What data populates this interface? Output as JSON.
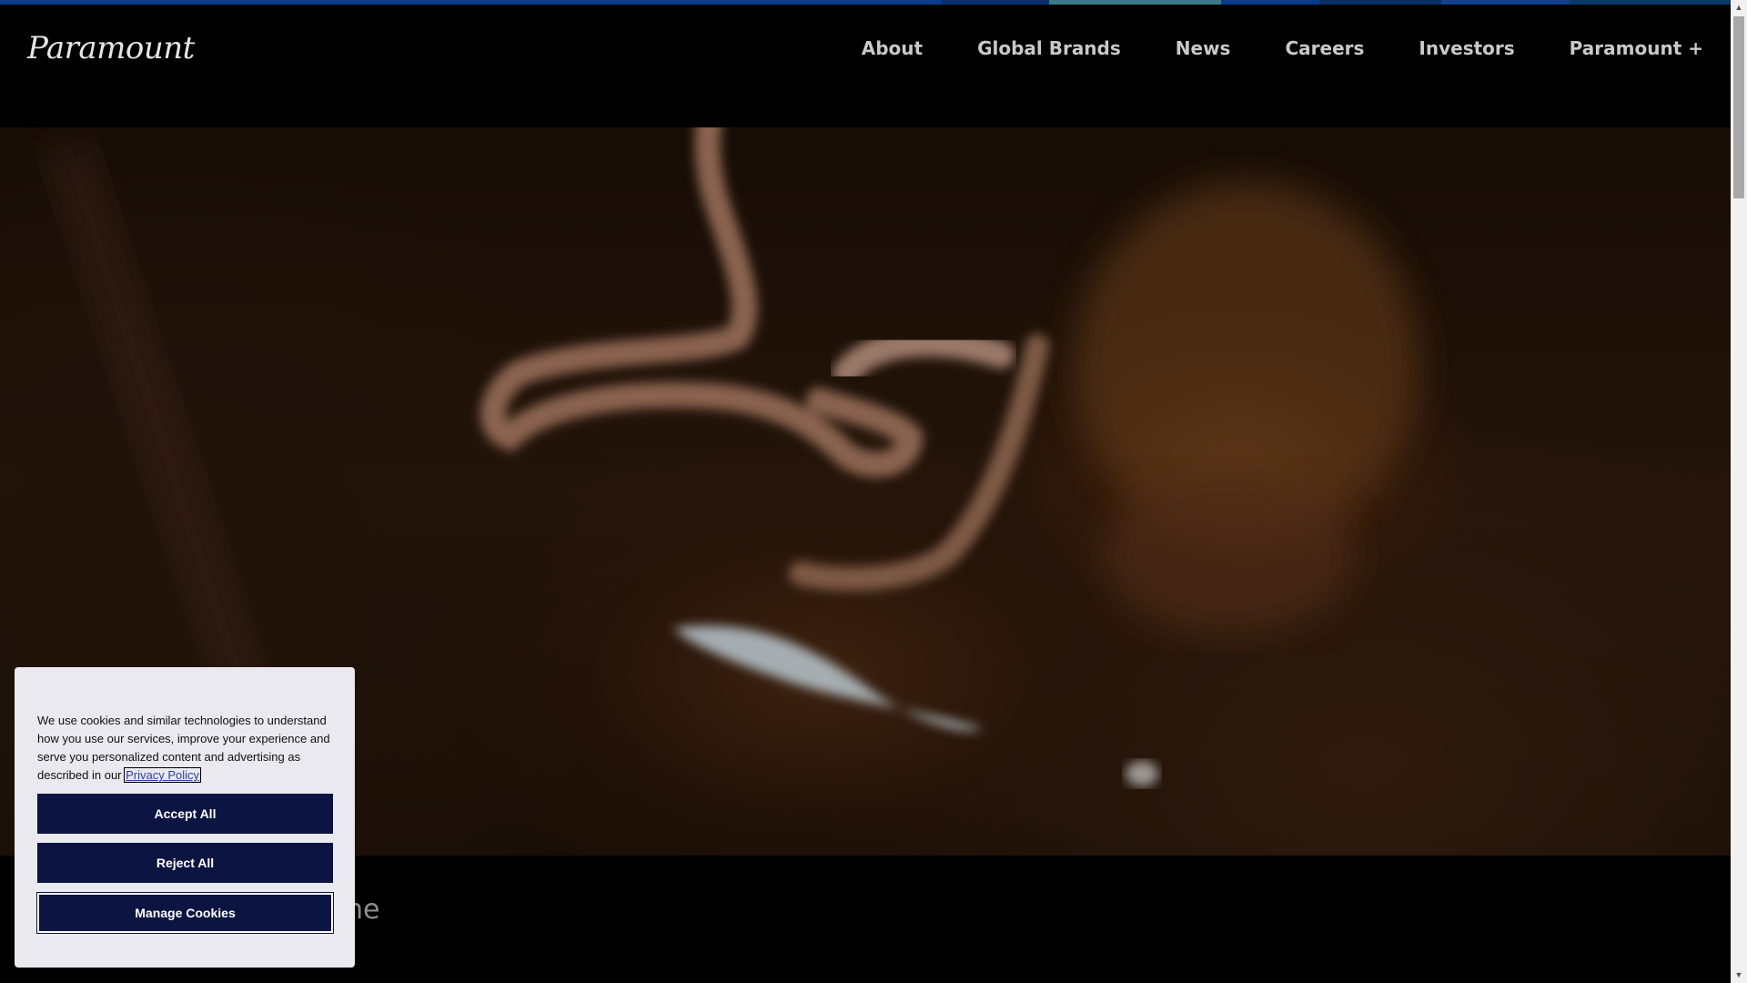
{
  "brand": {
    "logo_text": "Paramount"
  },
  "nav": {
    "items": [
      {
        "label": "About"
      },
      {
        "label": "Global Brands"
      },
      {
        "label": "News"
      },
      {
        "label": "Careers"
      },
      {
        "label": "Investors"
      },
      {
        "label": "Paramount +"
      }
    ]
  },
  "colors": {
    "stripe": [
      "#0a3b8c",
      "#0a3b8c",
      "#0a3b8c",
      "#3a7a86",
      "#0a3b8c",
      "#11408f",
      "#0a3b8c",
      "#0b3a6a"
    ],
    "cookie_button": "#0c1442",
    "cookie_bg": "#e9e9ef"
  },
  "hero": {
    "description": ""
  },
  "below_hero": {
    "partial_text": "ne"
  },
  "cookie_banner": {
    "text": "We use cookies and similar technologies to understand how you use our services, improve your experience and serve you personalized content and advertising as described in our",
    "privacy_link": "Privacy Policy",
    "accept_label": "Accept All",
    "reject_label": "Reject All",
    "manage_label": "Manage Cookies"
  },
  "scrollbar": {
    "up_icon": "triangle-up",
    "down_icon": "triangle-down"
  }
}
